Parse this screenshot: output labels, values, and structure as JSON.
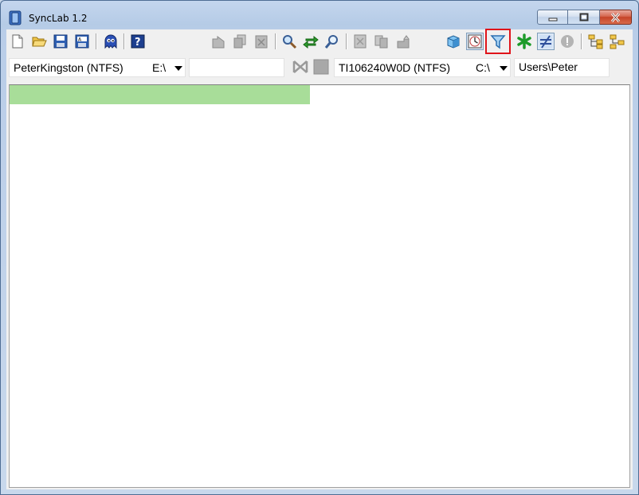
{
  "window": {
    "title": "SyncLab 1.2"
  },
  "toolbar": {
    "items": [
      {
        "name": "new-icon",
        "enabled": true
      },
      {
        "name": "open-folder-icon",
        "enabled": true
      },
      {
        "name": "save-icon",
        "enabled": true
      },
      {
        "name": "save-as-icon",
        "enabled": true
      },
      {
        "name": "ghost-icon",
        "enabled": true
      },
      {
        "name": "help-icon",
        "enabled": true
      },
      {
        "name": "copy-left-icon",
        "enabled": false
      },
      {
        "name": "copy-both-icon",
        "enabled": false
      },
      {
        "name": "delete-icon",
        "enabled": false
      },
      {
        "name": "search-icon",
        "enabled": true
      },
      {
        "name": "sync-arrows-icon",
        "enabled": true
      },
      {
        "name": "magnifier-icon",
        "enabled": true
      },
      {
        "name": "exclude-icon",
        "enabled": false
      },
      {
        "name": "duplicate-icon",
        "enabled": false
      },
      {
        "name": "move-icon",
        "enabled": false
      },
      {
        "name": "cube-icon",
        "enabled": true
      },
      {
        "name": "clock-icon",
        "enabled": true,
        "pressed": true
      },
      {
        "name": "filter-icon",
        "enabled": true,
        "highlighted": true
      },
      {
        "name": "asterisk-icon",
        "enabled": true
      },
      {
        "name": "not-equal-icon",
        "enabled": true,
        "pressed": true
      },
      {
        "name": "warning-icon",
        "enabled": false
      },
      {
        "name": "tree-expand-icon",
        "enabled": true
      },
      {
        "name": "tree-collapse-icon",
        "enabled": true
      }
    ]
  },
  "left": {
    "volume": "PeterKingston (NTFS)",
    "drive": "E:\\",
    "path": ""
  },
  "right": {
    "volume": "TI106240W0D (NTFS)",
    "drive": "C:\\",
    "path": "Users\\Peter"
  },
  "progress": {
    "fraction": 0.485,
    "color": "#a8dd99"
  },
  "colors": {
    "highlight_outline": "#e0141a",
    "window_frame": "#b9cde8"
  }
}
